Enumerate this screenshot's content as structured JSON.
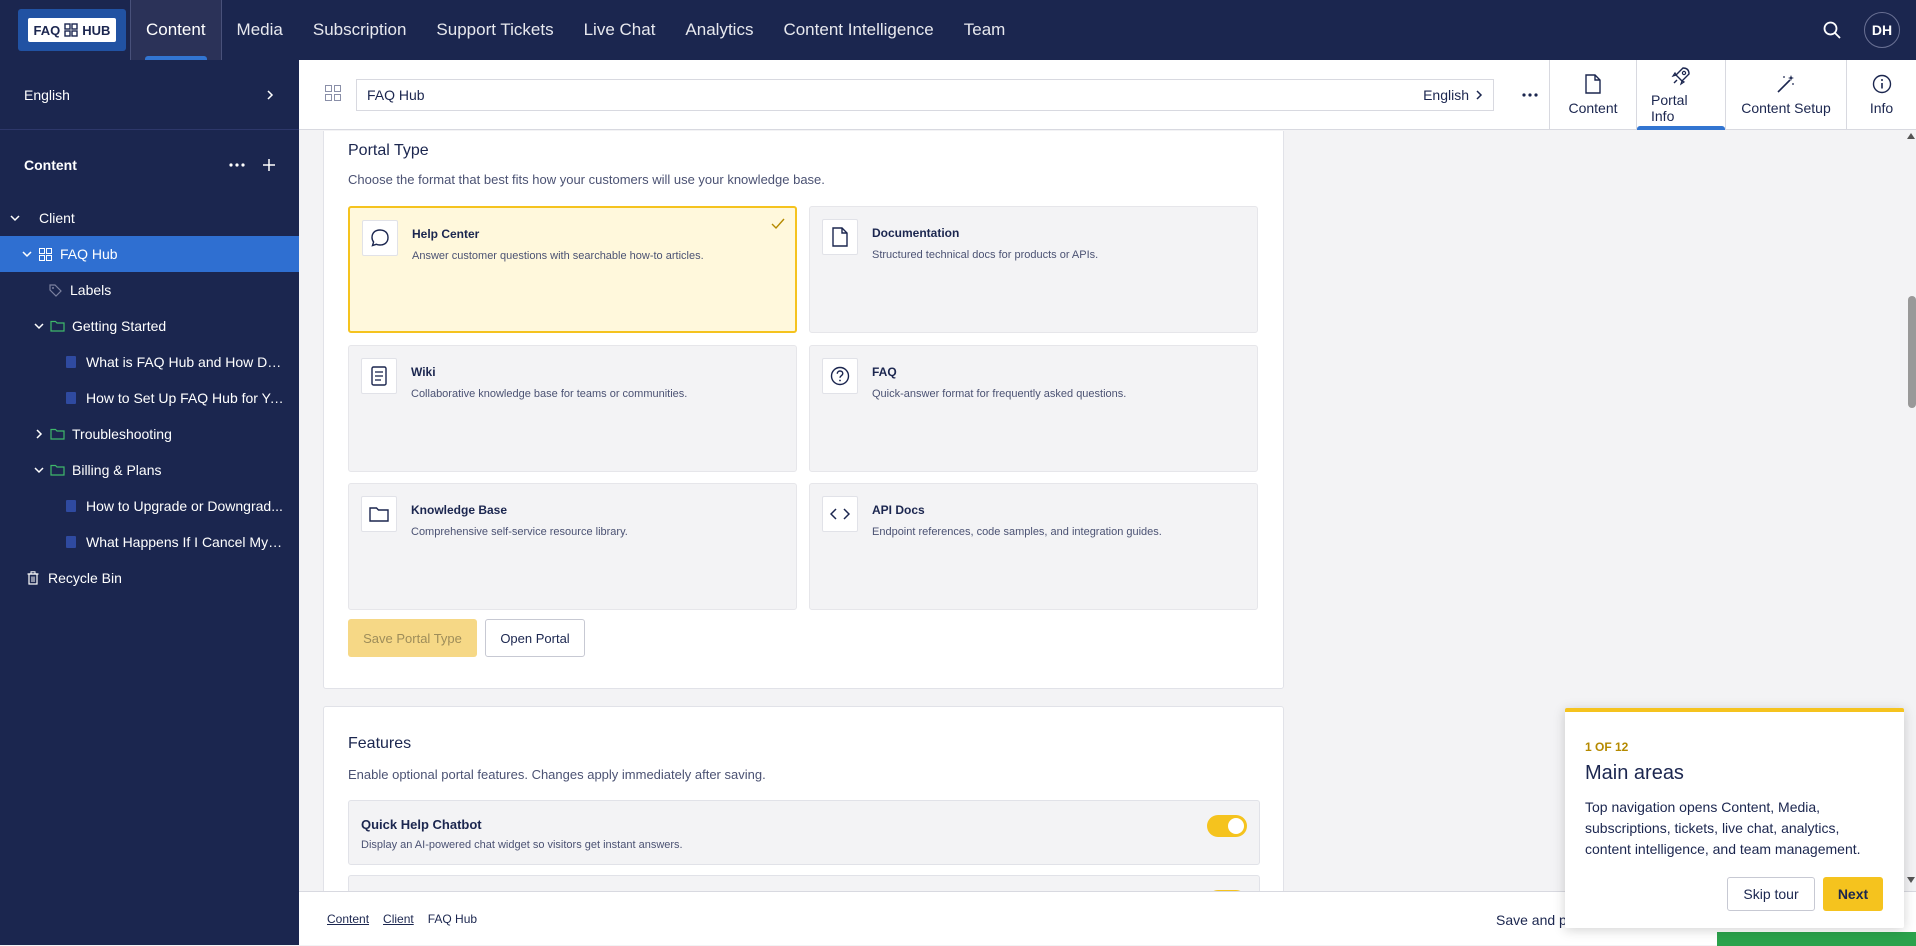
{
  "logo": {
    "text_left": "FAQ",
    "text_right": "HUB"
  },
  "topnav": {
    "items": [
      "Content",
      "Media",
      "Subscription",
      "Support Tickets",
      "Live Chat",
      "Analytics",
      "Content Intelligence",
      "Team"
    ],
    "active": "Content",
    "avatar": "DH"
  },
  "sidebar": {
    "language": "English",
    "section_title": "Content",
    "tree": [
      {
        "label": "Client"
      },
      {
        "label": "FAQ Hub"
      },
      {
        "label": "Labels"
      },
      {
        "label": "Getting Started"
      },
      {
        "label": "What is FAQ Hub and How Do..."
      },
      {
        "label": "How to Set Up FAQ Hub for Yo..."
      },
      {
        "label": "Troubleshooting"
      },
      {
        "label": "Billing & Plans"
      },
      {
        "label": "How to Upgrade or Downgrad..."
      },
      {
        "label": "What Happens If I Cancel My F..."
      },
      {
        "label": "Recycle Bin"
      }
    ]
  },
  "subheader": {
    "path": "FAQ Hub",
    "language": "English",
    "apps": [
      "Content",
      "Portal Info",
      "Content Setup",
      "Info"
    ],
    "active_app": "Portal Info"
  },
  "portal_type": {
    "title": "Portal Type",
    "description": "Choose the format that best fits how your customers will use your knowledge base.",
    "options": [
      {
        "title": "Help Center",
        "desc": "Answer customer questions with searchable how-to articles.",
        "icon": "chat-bubble-icon",
        "selected": true
      },
      {
        "title": "Documentation",
        "desc": "Structured technical docs for products or APIs.",
        "icon": "document-icon",
        "selected": false
      },
      {
        "title": "Wiki",
        "desc": "Collaborative knowledge base for teams or communities.",
        "icon": "book-icon",
        "selected": false
      },
      {
        "title": "FAQ",
        "desc": "Quick-answer format for frequently asked questions.",
        "icon": "question-circle-icon",
        "selected": false
      },
      {
        "title": "Knowledge Base",
        "desc": "Comprehensive self-service resource library.",
        "icon": "folder-icon",
        "selected": false
      },
      {
        "title": "API Docs",
        "desc": "Endpoint references, code samples, and integration guides.",
        "icon": "code-icon",
        "selected": false
      }
    ],
    "save_label": "Save Portal Type",
    "open_label": "Open Portal"
  },
  "features": {
    "title": "Features",
    "description": "Enable optional portal features. Changes apply immediately after saving.",
    "items": [
      {
        "title": "Quick Help Chatbot",
        "desc": "Display an AI-powered chat widget so visitors get instant answers.",
        "enabled": true
      }
    ]
  },
  "bottombar": {
    "breadcrumb": [
      "Content",
      "Client",
      "FAQ Hub"
    ],
    "save_label": "Save and p"
  },
  "tour": {
    "step": "1 OF 12",
    "title": "Main areas",
    "body": "Top navigation opens Content, Media, subscriptions, tickets, live chat, analytics, content intelligence, and team management.",
    "skip": "Skip tour",
    "next": "Next"
  },
  "colors": {
    "navy": "#1b264f",
    "accent_blue": "#2f6fd1",
    "yellow": "#f5c31e",
    "green": "#2ba24c"
  }
}
